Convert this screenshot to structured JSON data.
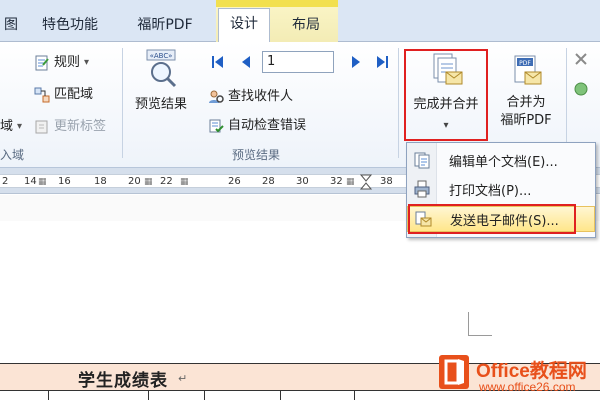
{
  "tabs": {
    "partial": "图",
    "features": "特色功能",
    "pdf": "福昕PDF",
    "design": "设计",
    "layout": "布局"
  },
  "ribbon": {
    "rules": "规则",
    "rules_arrow": "▾",
    "match_fields": "匹配域",
    "field_partial": "域",
    "field_partial_arrow": "▾",
    "update_labels": "更新标签",
    "insert_group_partial": "入域",
    "preview_results": "预览结果",
    "record_number": "1",
    "find_recipient": "查找收件人",
    "auto_check_errors": "自动检查错误",
    "preview_group": "预览结果",
    "finish_merge": "完成并合并",
    "finish_merge_arrow": "▾",
    "merge_pdf_line1": "合并为",
    "merge_pdf_line2": "福昕PDF"
  },
  "menu": {
    "items": [
      {
        "label": "编辑单个文档(E)..."
      },
      {
        "label": "打印文档(P)..."
      },
      {
        "label": "发送电子邮件(S)..."
      }
    ]
  },
  "ruler": {
    "numbers": [
      "2",
      "14",
      "16",
      "18",
      "20",
      "22",
      "26",
      "28",
      "30",
      "32",
      "38"
    ]
  },
  "document": {
    "table_title": "学生成绩表",
    "paragraph_mark": "↵"
  },
  "watermark": {
    "brand": "Office教程网",
    "url": "www.office26.com"
  },
  "colors": {
    "highlight_red": "#e02020",
    "accent_orange": "#e8501b",
    "table_header_bg": "#fbe4d5"
  }
}
